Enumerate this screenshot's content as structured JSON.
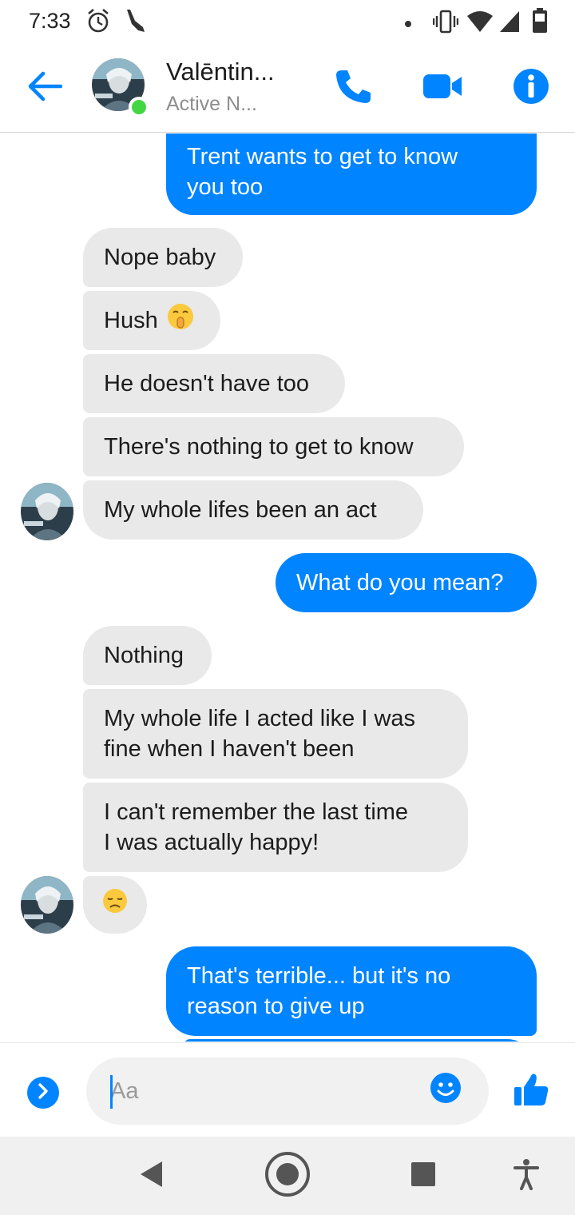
{
  "status_bar": {
    "time": "7:33",
    "icons": [
      "alarm-icon",
      "bird-icon",
      "dot-icon",
      "vibrate-icon",
      "wifi-icon",
      "signal-icon",
      "battery-icon"
    ]
  },
  "header": {
    "contact_name": "Valēntin...",
    "contact_status": "Active N...",
    "icons": [
      "back-arrow-icon",
      "phone-icon",
      "video-camera-icon",
      "info-icon"
    ]
  },
  "messages": [
    {
      "from": "me",
      "lines": [
        "Trent wants to get to know",
        "you too"
      ]
    },
    {
      "from": "them",
      "lines": [
        "Nope baby"
      ]
    },
    {
      "from": "them",
      "lines": [
        "Hush"
      ],
      "emoji": "shushing-face-icon"
    },
    {
      "from": "them",
      "lines": [
        "He doesn't have too"
      ]
    },
    {
      "from": "them",
      "lines": [
        "There's nothing to get to know"
      ]
    },
    {
      "from": "them",
      "lines": [
        "My whole lifes been an act"
      ]
    },
    {
      "from": "me",
      "lines": [
        "What do you mean?"
      ]
    },
    {
      "from": "them",
      "lines": [
        "Nothing"
      ]
    },
    {
      "from": "them",
      "lines": [
        "My whole life I acted like I was",
        "fine when I haven't been"
      ]
    },
    {
      "from": "them",
      "lines": [
        "I can't remember the last time",
        "I was actually happy!"
      ]
    },
    {
      "from": "them",
      "lines": [
        ""
      ],
      "emoji": "disappointed-face-icon"
    },
    {
      "from": "me",
      "lines": [
        "That's terrible... but it's no",
        "reason to give up"
      ]
    }
  ],
  "composer": {
    "placeholder": "Aa",
    "icons": [
      "expand-chevron-icon",
      "emoji-smiley-icon",
      "thumbs-up-icon"
    ]
  },
  "nav_bar": {
    "icons": [
      "back-triangle-icon",
      "home-circle-icon",
      "recents-square-icon",
      "accessibility-icon"
    ]
  },
  "colors": {
    "accent": "#0084ff",
    "incoming_bubble": "#e9e9e9",
    "online": "#42d742",
    "nav_bar_bg": "#f0f0f0"
  }
}
